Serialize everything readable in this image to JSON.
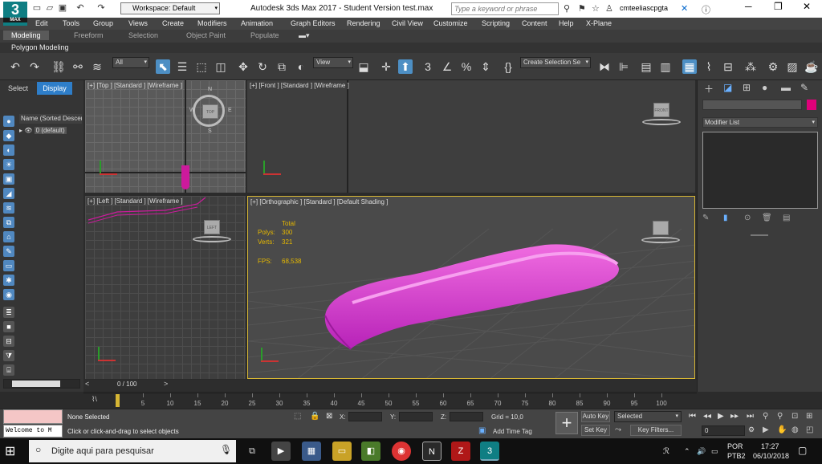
{
  "titlebar": {
    "logo_text": "3",
    "logo_sub": "MAX",
    "workspace": "Workspace: Default",
    "title": "Autodesk 3ds Max 2017 - Student Version    test.max",
    "search_placeholder": "Type a keyword or phrase",
    "user": "cmteeliascpgta"
  },
  "menus": [
    "Edit",
    "Tools",
    "Group",
    "Views",
    "Create",
    "Modifiers",
    "Animation",
    "Graph Editors",
    "Rendering",
    "Civil View",
    "Customize",
    "Scripting",
    "Content",
    "Help",
    "X-Plane"
  ],
  "ribbon": {
    "tabs": [
      "Modeling",
      "Freeform",
      "Selection",
      "Object Paint",
      "Populate"
    ],
    "panel_button": "Polygon Modeling"
  },
  "toolbar": {
    "filter_dropdown": "All",
    "refcoord_dropdown": "View",
    "named_selection": "Create Selection Se"
  },
  "leftpanel": {
    "tab_select": "Select",
    "tab_display": "Display",
    "column_header": "Name (Sorted Descen",
    "layer_row": "0 (default)"
  },
  "viewports": {
    "top": {
      "label": "[+] [Top ] [Standard ] [Wireframe ]"
    },
    "front": {
      "label": "[+] [Front ] [Standard ] [Wireframe ]"
    },
    "left": {
      "label": "[+] [Left ] [Standard ] [Wireframe ]"
    },
    "persp": {
      "label": "[+] [Orthographic ] [Standard ] [Default Shading ]"
    }
  },
  "viewcube_labels": {
    "top": "TOP",
    "front": "FRONT",
    "left": "LEFT",
    "compass_w": "W",
    "compass_e": "E",
    "compass_s": "S",
    "compass_n": "N"
  },
  "stats": {
    "total_label": "Total",
    "polys_label": "Polys:",
    "polys_value": "300",
    "verts_label": "Verts:",
    "verts_value": "321",
    "fps_label": "FPS:",
    "fps_value": "68,538"
  },
  "cmdpanel": {
    "modifier_list": "Modifier List",
    "object_color": "#e0007a"
  },
  "timeline": {
    "slider_label": "0 / 100",
    "ticks": [
      "5",
      "10",
      "15",
      "20",
      "25",
      "30",
      "35",
      "40",
      "45",
      "50",
      "55",
      "60",
      "65",
      "70",
      "75",
      "80",
      "85",
      "90",
      "95",
      "100"
    ]
  },
  "status": {
    "cmd_output": "Welcome to M",
    "selection": "None Selected",
    "prompt": "Click or click-and-drag to select objects",
    "x_label": "X:",
    "y_label": "Y:",
    "z_label": "Z:",
    "grid": "Grid = 10,0",
    "add_time_tag": "Add Time Tag",
    "auto_key": "Auto Key",
    "set_key": "Set Key",
    "selected_dd": "Selected",
    "key_filters": "Key Filters...",
    "frame": "0"
  },
  "taskbar": {
    "search_placeholder": "Digite aqui para pesquisar",
    "lang": "POR",
    "layout": "PTB2",
    "time": "17:27",
    "date": "06/10/2018"
  }
}
